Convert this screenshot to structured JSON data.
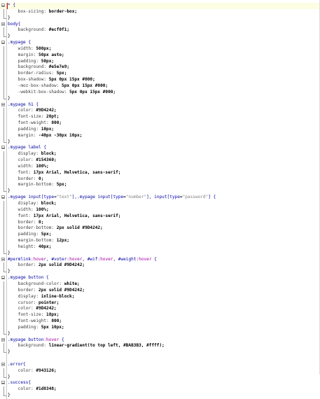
{
  "editor": {
    "lines": [
      {
        "fold": "start",
        "tokens": [
          {
            "t": "* {",
            "c": "sel"
          }
        ]
      },
      {
        "fold": "mid",
        "tokens": [
          {
            "t": "    box-sizing: ",
            "c": "prop"
          },
          {
            "t": "border-box;",
            "c": "val"
          }
        ]
      },
      {
        "fold": "end",
        "tokens": [
          {
            "t": "}",
            "c": "punct"
          }
        ]
      },
      {
        "fold": "start",
        "tokens": [
          {
            "t": "body{",
            "c": "sel"
          }
        ]
      },
      {
        "fold": "mid",
        "tokens": [
          {
            "t": "    background: ",
            "c": "prop"
          },
          {
            "t": "#ecf0f1;",
            "c": "val"
          }
        ]
      },
      {
        "fold": "end",
        "tokens": [
          {
            "t": "}",
            "c": "punct"
          }
        ]
      },
      {
        "fold": "start",
        "tokens": [
          {
            "t": ".mypage {",
            "c": "sel"
          }
        ]
      },
      {
        "fold": "mid",
        "tokens": [
          {
            "t": "    width: ",
            "c": "prop"
          },
          {
            "t": "500px;",
            "c": "val"
          }
        ]
      },
      {
        "fold": "mid",
        "tokens": [
          {
            "t": "    margin: ",
            "c": "prop"
          },
          {
            "t": "50px auto;",
            "c": "val"
          }
        ]
      },
      {
        "fold": "mid",
        "tokens": [
          {
            "t": "    padding: ",
            "c": "prop"
          },
          {
            "t": "50px;",
            "c": "val"
          }
        ]
      },
      {
        "fold": "mid",
        "tokens": [
          {
            "t": "    background: ",
            "c": "prop"
          },
          {
            "t": "#e5e7e9;",
            "c": "val"
          }
        ]
      },
      {
        "fold": "mid",
        "tokens": [
          {
            "t": "    border-radius: ",
            "c": "prop"
          },
          {
            "t": "5px;",
            "c": "val"
          }
        ]
      },
      {
        "fold": "mid",
        "tokens": [
          {
            "t": "    box-shadow: ",
            "c": "prop"
          },
          {
            "t": "5px 0px 15px #000;",
            "c": "val"
          }
        ]
      },
      {
        "fold": "mid",
        "tokens": [
          {
            "t": "    -moz-box-shadow: ",
            "c": "prop"
          },
          {
            "t": "5px 0px 15px #000;",
            "c": "val"
          }
        ]
      },
      {
        "fold": "mid",
        "tokens": [
          {
            "t": "    -webkit-box-shadow: ",
            "c": "prop"
          },
          {
            "t": "5px 0px 15px #000;",
            "c": "val"
          }
        ]
      },
      {
        "fold": "end",
        "tokens": [
          {
            "t": "}",
            "c": "punct"
          }
        ]
      },
      {
        "fold": "start",
        "tokens": [
          {
            "t": ".mypage h1 {",
            "c": "sel"
          }
        ]
      },
      {
        "fold": "mid",
        "tokens": [
          {
            "t": "    color: ",
            "c": "prop"
          },
          {
            "t": "#9D4242;",
            "c": "val"
          }
        ]
      },
      {
        "fold": "mid",
        "tokens": [
          {
            "t": "    font-size: ",
            "c": "prop"
          },
          {
            "t": "20pt;",
            "c": "val"
          }
        ]
      },
      {
        "fold": "mid",
        "tokens": [
          {
            "t": "    font-weight: ",
            "c": "prop"
          },
          {
            "t": "800;",
            "c": "val"
          }
        ]
      },
      {
        "fold": "mid",
        "tokens": [
          {
            "t": "    padding: ",
            "c": "prop"
          },
          {
            "t": "10px;",
            "c": "val"
          }
        ]
      },
      {
        "fold": "mid",
        "tokens": [
          {
            "t": "    margin: ",
            "c": "prop"
          },
          {
            "t": "-40px -30px 10px;",
            "c": "val"
          }
        ]
      },
      {
        "fold": "end",
        "tokens": [
          {
            "t": "}",
            "c": "punct"
          }
        ]
      },
      {
        "fold": "start",
        "tokens": [
          {
            "t": ".mypage label {",
            "c": "sel"
          }
        ]
      },
      {
        "fold": "mid",
        "tokens": [
          {
            "t": "    display: ",
            "c": "prop"
          },
          {
            "t": "block;",
            "c": "val"
          }
        ]
      },
      {
        "fold": "mid",
        "tokens": [
          {
            "t": "    color: ",
            "c": "prop"
          },
          {
            "t": "#154360;",
            "c": "val"
          }
        ]
      },
      {
        "fold": "mid",
        "tokens": [
          {
            "t": "    width: ",
            "c": "prop"
          },
          {
            "t": "100%;",
            "c": "val"
          }
        ]
      },
      {
        "fold": "mid",
        "tokens": [
          {
            "t": "    font: ",
            "c": "prop"
          },
          {
            "t": "17px Arial, Helvetica, sans-serif;",
            "c": "val"
          }
        ]
      },
      {
        "fold": "mid",
        "tokens": [
          {
            "t": "    border: ",
            "c": "prop"
          },
          {
            "t": "0;",
            "c": "val"
          }
        ]
      },
      {
        "fold": "mid",
        "tokens": [
          {
            "t": "    margin-bottom: ",
            "c": "prop"
          },
          {
            "t": "5px;",
            "c": "val"
          }
        ]
      },
      {
        "fold": "end",
        "tokens": [
          {
            "t": "}",
            "c": "punct"
          }
        ]
      },
      {
        "fold": "start",
        "tokens": [
          {
            "t": ".mypage input[",
            "c": "sel"
          },
          {
            "t": "type",
            "c": "kw"
          },
          {
            "t": "=",
            "c": "punct"
          },
          {
            "t": "\"text\"",
            "c": "str"
          },
          {
            "t": "],.mypage input[",
            "c": "sel"
          },
          {
            "t": "type",
            "c": "kw"
          },
          {
            "t": "=",
            "c": "punct"
          },
          {
            "t": "\"number\"",
            "c": "str"
          },
          {
            "t": "], input[",
            "c": "sel"
          },
          {
            "t": "type",
            "c": "kw"
          },
          {
            "t": "=",
            "c": "punct"
          },
          {
            "t": "\"password\"",
            "c": "str"
          },
          {
            "t": "] {",
            "c": "sel"
          }
        ]
      },
      {
        "fold": "mid",
        "tokens": [
          {
            "t": "    display: ",
            "c": "prop"
          },
          {
            "t": "block;",
            "c": "val"
          }
        ]
      },
      {
        "fold": "mid",
        "tokens": [
          {
            "t": "    width: ",
            "c": "prop"
          },
          {
            "t": "100%;",
            "c": "val"
          }
        ]
      },
      {
        "fold": "mid",
        "tokens": [
          {
            "t": "    font: ",
            "c": "prop"
          },
          {
            "t": "17px Arial, Helvetica, sans-serif;",
            "c": "val"
          }
        ]
      },
      {
        "fold": "mid",
        "tokens": [
          {
            "t": "    border: ",
            "c": "prop"
          },
          {
            "t": "0;",
            "c": "val"
          }
        ]
      },
      {
        "fold": "mid",
        "tokens": [
          {
            "t": "    border-bottom: ",
            "c": "prop"
          },
          {
            "t": "2px solid #9D4242;",
            "c": "val"
          }
        ]
      },
      {
        "fold": "mid",
        "tokens": [
          {
            "t": "    padding: ",
            "c": "prop"
          },
          {
            "t": "5px;",
            "c": "val"
          }
        ]
      },
      {
        "fold": "mid",
        "tokens": [
          {
            "t": "    margin-bottom: ",
            "c": "prop"
          },
          {
            "t": "12px;",
            "c": "val"
          }
        ]
      },
      {
        "fold": "mid",
        "tokens": [
          {
            "t": "    height: ",
            "c": "prop"
          },
          {
            "t": "40px;",
            "c": "val"
          }
        ]
      },
      {
        "fold": "end",
        "tokens": [
          {
            "t": "}",
            "c": "punct"
          }
        ]
      },
      {
        "fold": "start",
        "tokens": [
          {
            "t": "#permlink",
            "c": "sel"
          },
          {
            "t": ":hover",
            "c": "pseudo"
          },
          {
            "t": ", #voter",
            "c": "sel"
          },
          {
            "t": ":hover",
            "c": "pseudo"
          },
          {
            "t": ", #wif",
            "c": "sel"
          },
          {
            "t": ":hover",
            "c": "pseudo"
          },
          {
            "t": ", #weight",
            "c": "sel"
          },
          {
            "t": ":hover",
            "c": "pseudo"
          },
          {
            "t": " {",
            "c": "sel"
          }
        ]
      },
      {
        "fold": "mid",
        "tokens": [
          {
            "t": "    border: ",
            "c": "prop"
          },
          {
            "t": "2px solid #9D4242;",
            "c": "val"
          }
        ]
      },
      {
        "fold": "end",
        "tokens": [
          {
            "t": "}",
            "c": "punct"
          }
        ]
      },
      {
        "fold": "start",
        "tokens": [
          {
            "t": ".mypage button {",
            "c": "sel"
          }
        ]
      },
      {
        "fold": "mid",
        "tokens": [
          {
            "t": "    background-color: ",
            "c": "prop"
          },
          {
            "t": "white;",
            "c": "val"
          }
        ]
      },
      {
        "fold": "mid",
        "tokens": [
          {
            "t": "    border: ",
            "c": "prop"
          },
          {
            "t": "2px solid #9D4242;",
            "c": "val"
          }
        ]
      },
      {
        "fold": "mid",
        "tokens": [
          {
            "t": "    display: ",
            "c": "prop"
          },
          {
            "t": "inline-block;",
            "c": "val"
          }
        ]
      },
      {
        "fold": "mid",
        "tokens": [
          {
            "t": "    cursor: ",
            "c": "prop"
          },
          {
            "t": "pointer;",
            "c": "val"
          }
        ]
      },
      {
        "fold": "mid",
        "tokens": [
          {
            "t": "    color: ",
            "c": "prop"
          },
          {
            "t": "#9D4242;",
            "c": "val"
          }
        ]
      },
      {
        "fold": "mid",
        "tokens": [
          {
            "t": "    font-size: ",
            "c": "prop"
          },
          {
            "t": "18px;",
            "c": "val"
          }
        ]
      },
      {
        "fold": "mid",
        "tokens": [
          {
            "t": "    font-weight: ",
            "c": "prop"
          },
          {
            "t": "800;",
            "c": "val"
          }
        ]
      },
      {
        "fold": "mid",
        "tokens": [
          {
            "t": "    padding: ",
            "c": "prop"
          },
          {
            "t": "5px 10px;",
            "c": "val"
          }
        ]
      },
      {
        "fold": "end",
        "tokens": [
          {
            "t": "}",
            "c": "punct"
          }
        ]
      },
      {
        "fold": "start",
        "tokens": [
          {
            "t": ".mypage button",
            "c": "sel"
          },
          {
            "t": ":hover",
            "c": "pseudo"
          },
          {
            "t": " {",
            "c": "sel"
          }
        ]
      },
      {
        "fold": "mid",
        "tokens": [
          {
            "t": "    background: ",
            "c": "prop"
          },
          {
            "t": "linear-gradient(to top left, #BAB3B3, #ffff);",
            "c": "val"
          }
        ]
      },
      {
        "fold": "end",
        "tokens": [
          {
            "t": "}",
            "c": "punct"
          }
        ]
      },
      {
        "fold": "none",
        "tokens": []
      },
      {
        "fold": "start",
        "tokens": [
          {
            "t": ".error{",
            "c": "sel"
          }
        ]
      },
      {
        "fold": "mid",
        "tokens": [
          {
            "t": "    color: ",
            "c": "prop"
          },
          {
            "t": "#943126;",
            "c": "val"
          }
        ]
      },
      {
        "fold": "end",
        "tokens": [
          {
            "t": "}",
            "c": "punct"
          }
        ]
      },
      {
        "fold": "start",
        "tokens": [
          {
            "t": ".success{",
            "c": "sel"
          }
        ]
      },
      {
        "fold": "mid",
        "tokens": [
          {
            "t": "    color: ",
            "c": "prop"
          },
          {
            "t": "#1d8348;",
            "c": "val"
          }
        ]
      },
      {
        "fold": "end",
        "tokens": [
          {
            "t": "}",
            "c": "punct"
          }
        ]
      }
    ]
  }
}
